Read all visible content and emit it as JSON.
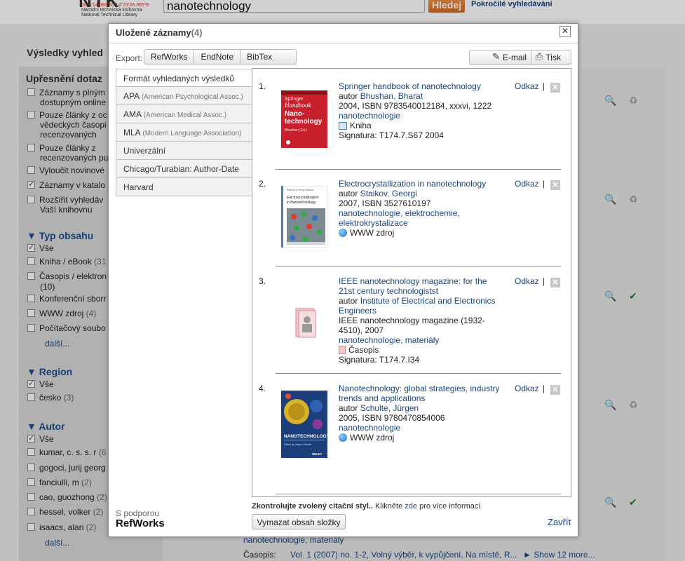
{
  "header": {
    "logo_text": "NTK",
    "logo_coords": "50°6'14.083\"N, 14°23'26.365\"E",
    "logo_line2": "Národní technická knihovna",
    "logo_line3": "National Technical Library",
    "search_value": "nanotechnology",
    "search_button": "Hledej",
    "advanced_link": "Pokročilé vyhledávání"
  },
  "background": {
    "results_title": "Výsledky vyhled",
    "refine_title": "Upřesnění dotaz",
    "filters": [
      {
        "label": "Záznamy s plným",
        "label2": "dostupným online",
        "checked": false
      },
      {
        "label": "Pouze články z oc",
        "label2": "vědeckých časopi",
        "label3": "recenzovaných",
        "checked": false
      },
      {
        "label": "Pouze články z",
        "label2": "recenzovaných pu",
        "checked": false
      },
      {
        "label": "Vyloučit novinové",
        "checked": false
      },
      {
        "label": "Záznamy v katalo",
        "checked": true
      },
      {
        "label": "Rozšířit vyhledáv",
        "label2": "Vaší knihovnu",
        "checked": false
      }
    ],
    "type_heading": "Typ obsahu",
    "type_items": [
      {
        "label": "Vše",
        "count": "",
        "checked": true
      },
      {
        "label": "Kniha / eBook",
        "count": "(31",
        "checked": false
      },
      {
        "label": "Časopis / elektron",
        "count": "",
        "count2": "(10)",
        "checked": false
      },
      {
        "label": "Konferenční sborr",
        "count": "",
        "checked": false
      },
      {
        "label": "WWW zdroj",
        "count": "(4)",
        "checked": false
      },
      {
        "label": "Počítačový soubo",
        "count": "",
        "checked": false
      }
    ],
    "more": "další...",
    "region_heading": "Region",
    "region_items": [
      {
        "label": "Vše",
        "count": "",
        "checked": true
      },
      {
        "label": "česko",
        "count": "(3)",
        "checked": false
      }
    ],
    "author_heading": "Autor",
    "author_items": [
      {
        "label": "Vše",
        "count": "",
        "checked": true
      },
      {
        "label": "kumar, c. s. s. r",
        "count": "(6",
        "checked": false
      },
      {
        "label": "gogoci, jurij georg",
        "count": "",
        "checked": false
      },
      {
        "label": "fanciulli, m",
        "count": "(2)",
        "checked": false
      },
      {
        "label": "cao, guozhong",
        "count": "(2)",
        "checked": false
      },
      {
        "label": "hessel, volker",
        "count": "(2)",
        "checked": false
      },
      {
        "label": "isaacs, alan",
        "count": "(2)",
        "checked": false
      }
    ],
    "bottom_subject": "nanotechnologie, materiály",
    "bottom_type": "Časopis:",
    "bottom_holdings": "Vol. 1 (2007) no. 1-2, Volný výběr, k vypůjčení, Na místě, R...",
    "bottom_show_more": "► Show 12 more..."
  },
  "modal": {
    "title": "Uložené záznamy",
    "count": "(4)",
    "close_glyph": "✕",
    "export_label": "Export:",
    "export_buttons": [
      "RefWorks",
      "EndNote",
      "BibTex"
    ],
    "email_label": "E-mail",
    "print_label": "Tisk",
    "styles": [
      {
        "name": "Formát vyhledaných výsledků",
        "sub": "",
        "active": true
      },
      {
        "name": "APA",
        "sub": "(American Psychological Assoc.)",
        "active": false
      },
      {
        "name": "AMA",
        "sub": "(American Medical Assoc.)",
        "active": false
      },
      {
        "name": "MLA",
        "sub": "(Modern Language Association)",
        "active": false
      },
      {
        "name": "Univerzální",
        "sub": "",
        "active": false
      },
      {
        "name": "Chicago/Turabian: Author-Date",
        "sub": "",
        "active": false
      },
      {
        "name": "Harvard",
        "sub": "",
        "active": false
      }
    ],
    "records": [
      {
        "num": "1.",
        "title": "Springer handbook of nanotechnology",
        "author_prefix": "autor",
        "author": "Bhushan, Bharat",
        "details": "2004, ISBN 9783540012184, xxxvi, 1222",
        "subjects": "nanotechnologie",
        "type": "Kniha",
        "signature": "Signatura: T174.7.S67 2004",
        "cover_text": "Springer Handbook of Nano-technology",
        "cover_small": "Bhushan (Ed.)"
      },
      {
        "num": "2.",
        "title": "Electrocrystallization in nanotechnology",
        "author_prefix": "autor",
        "author": "Staikov, Georgi",
        "details": "2007, ISBN 3527610197",
        "subjects": "nanotechnologie, elektrochemie, elektrokrystalizace",
        "type": "WWW zdroj",
        "cover_text": "Electrocrystallization in Nanotechnology",
        "cover_small": "Edited by Georgi Staikov"
      },
      {
        "num": "3.",
        "title": "IEEE nanotechnology magazine: for the 21st century technologistst",
        "author_prefix": "autor",
        "author": "Institute of Electrical and Electronics Engineers",
        "details": "IEEE nanotechnology magazine (1932-4510), 2007",
        "subjects": "nanotechnologie, materiály",
        "type": "Časopis",
        "signature": "Signatura: T174.7.I34"
      },
      {
        "num": "4.",
        "title": "Nanotechnology: global strategies, industry trends and applications",
        "author_prefix": "autor",
        "author": "Schulte, Jürgen",
        "details": "2005, ISBN 9780470854006",
        "subjects": "nanotechnologie",
        "type": "WWW zdroj",
        "cover_text": "NANOTECHNOLOGY",
        "cover_small": "Edited by Jürgen Schulte",
        "cover_publisher": "WILEY"
      }
    ],
    "link_label": "Odkaz",
    "link_sep": "|",
    "footer_bold": "Zkontrolujte zvolený citační styl..",
    "footer_text1": "Klikněte",
    "footer_link": "zde",
    "footer_text2": "pro více informací",
    "clear_button": "Vymazat obsah složky",
    "close_link": "Zavřít",
    "powered_by": "S podporou",
    "powered_brand": "RefWorks"
  },
  "colors": {
    "link": "#1a4480",
    "accent_orange": "#e07a2c",
    "springer_red": "#c8202c"
  }
}
